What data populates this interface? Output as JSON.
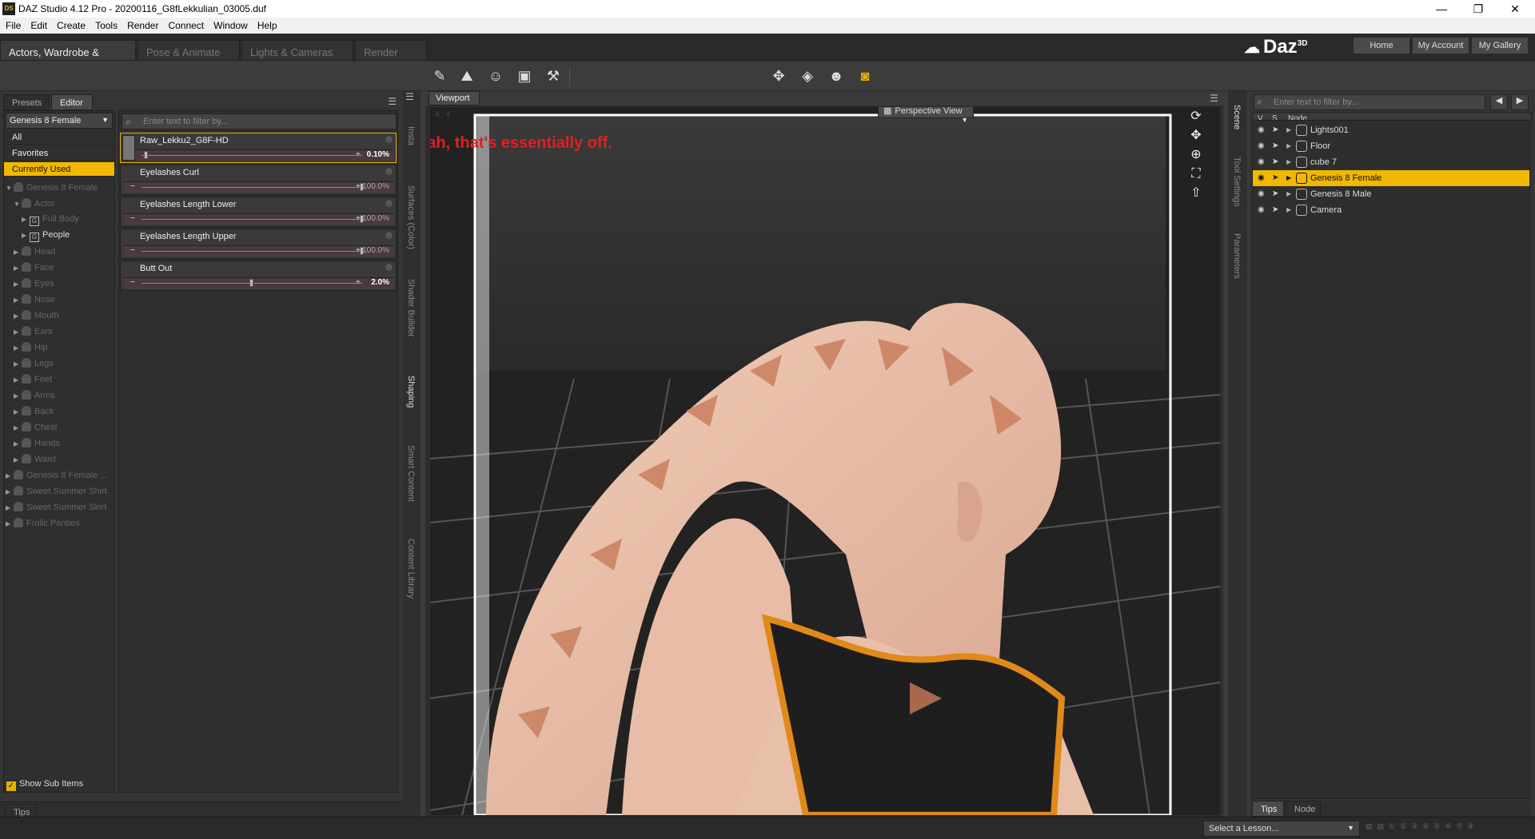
{
  "window": {
    "title": "DAZ Studio 4.12 Pro - 20200116_G8fLekkulian_03005.duf",
    "icon": "DS",
    "controls": [
      "—",
      "❐",
      "✕"
    ]
  },
  "menu": [
    "File",
    "Edit",
    "Create",
    "Tools",
    "Render",
    "Connect",
    "Window",
    "Help"
  ],
  "pane_tabs": [
    {
      "label": "Actors, Wardrobe & Props"
    },
    {
      "label": "Pose & Animate"
    },
    {
      "label": "Lights & Cameras"
    },
    {
      "label": "Render"
    }
  ],
  "brand": {
    "logo": "Daz",
    "sup": "3D"
  },
  "top_buttons": [
    "Home",
    "My Account",
    "My Gallery"
  ],
  "toolbar_icons": [
    "node-selection-icon",
    "scene-icon",
    "figure-icon",
    "props-icon",
    "joint-editor-icon",
    "universal-tool-icon",
    "camera-orbit-icon",
    "active-pose-icon",
    "render-icon"
  ],
  "left": {
    "tabs": [
      "Presets",
      "Editor"
    ],
    "figure_select": "Genesis 8 Female",
    "filter_placeholder": "Enter text to filter by...",
    "categories": [
      {
        "label": "All"
      },
      {
        "label": "Favorites"
      },
      {
        "label": "Currently Used"
      }
    ],
    "tree": [
      {
        "label": "Genesis 8 Female",
        "level": 0,
        "bright": false
      },
      {
        "label": "Actor",
        "level": 1,
        "bright": false
      },
      {
        "label": "Full Body",
        "level": 2,
        "bright": false,
        "group": true
      },
      {
        "label": "People",
        "level": 2,
        "bright": true,
        "group": true
      },
      {
        "label": "Head",
        "level": 1
      },
      {
        "label": "Face",
        "level": 1
      },
      {
        "label": "Eyes",
        "level": 1
      },
      {
        "label": "Nose",
        "level": 1
      },
      {
        "label": "Mouth",
        "level": 1
      },
      {
        "label": "Ears",
        "level": 1
      },
      {
        "label": "Hip",
        "level": 1
      },
      {
        "label": "Legs",
        "level": 1
      },
      {
        "label": "Feet",
        "level": 1
      },
      {
        "label": "Arms",
        "level": 1
      },
      {
        "label": "Back",
        "level": 1
      },
      {
        "label": "Chest",
        "level": 1
      },
      {
        "label": "Hands",
        "level": 1
      },
      {
        "label": "Waist",
        "level": 1
      },
      {
        "label": "Genesis 8 Female ...",
        "level": 0
      },
      {
        "label": "Sweet Summer Shirt",
        "level": 0
      },
      {
        "label": "Sweet Summer Skirt",
        "level": 0
      },
      {
        "label": "Frolic Panties",
        "level": 0
      }
    ],
    "sliders": [
      {
        "label": "Raw_Lekku2_G8F-HD",
        "value": "0.10%",
        "fraction": 0.001,
        "highlight": true
      },
      {
        "label": "Eyelashes Curl",
        "value": "100.0%",
        "fraction": 1.0
      },
      {
        "label": "Eyelashes Length Lower",
        "value": "100.0%",
        "fraction": 1.0
      },
      {
        "label": "Eyelashes Length Upper",
        "value": "100.0%",
        "fraction": 1.0
      },
      {
        "label": "Butt Out",
        "value": "2.0%",
        "fraction": 0.5,
        "bright": true
      }
    ],
    "show_sub_items": "Show Sub Items",
    "tips": "Tips"
  },
  "left_vertical_tabs": [
    "Insta",
    "Surfaces (Color)",
    "Shader Builder",
    "Shaping",
    "Smart Content",
    "Content Library"
  ],
  "viewport": {
    "tab": "Viewport",
    "aspect": "4 : 4",
    "view_select": "Perspective View",
    "annotation": "yeah, that's essentially off.",
    "annotation_color": "#e02020"
  },
  "right_vertical_tabs": [
    "Scene",
    "Tool Settings",
    "Parameters"
  ],
  "scene": {
    "filter_placeholder": "Enter text to filter by...",
    "columns": [
      "V",
      "S",
      "Node"
    ],
    "nodes": [
      {
        "label": "Lights001",
        "selected": false
      },
      {
        "label": "Floor",
        "selected": false
      },
      {
        "label": "cube 7",
        "selected": false
      },
      {
        "label": "Genesis 8 Female",
        "selected": true
      },
      {
        "label": "Genesis 8 Male",
        "selected": false
      },
      {
        "label": "Camera",
        "selected": false
      }
    ],
    "bottom_tabs": [
      "Tips",
      "Node"
    ]
  },
  "status": {
    "lesson": "Select a Lesson..."
  },
  "colors": {
    "accent": "#f0b800",
    "panel": "#353535",
    "dark": "#2a2a2a"
  }
}
